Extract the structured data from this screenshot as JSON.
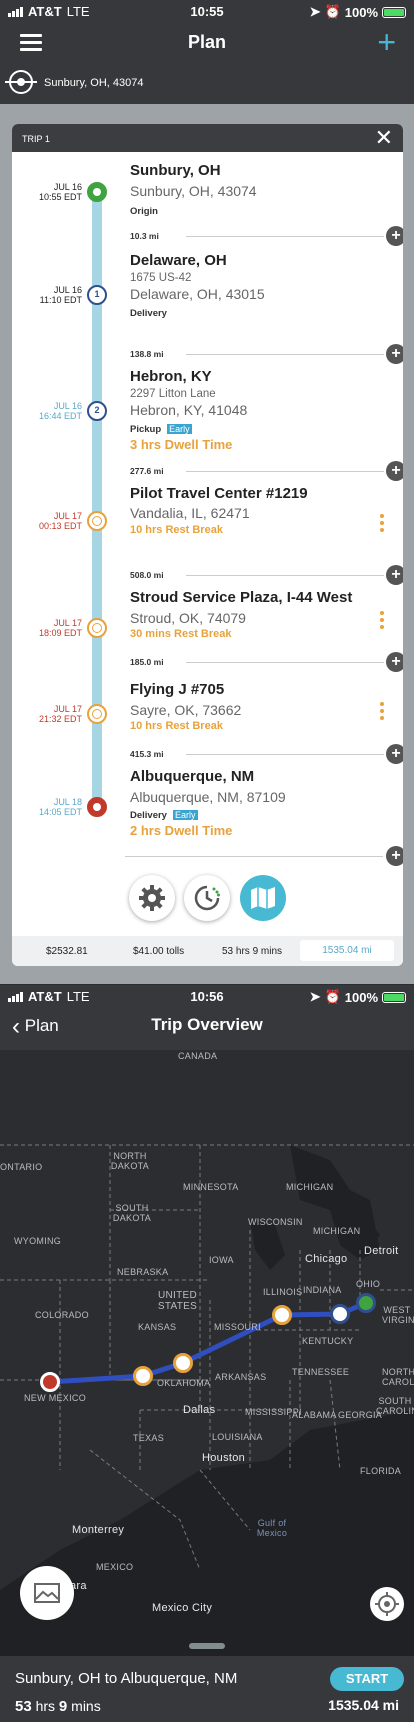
{
  "status1": {
    "carrier": "AT&T",
    "network": "LTE",
    "time": "10:55",
    "battery": "100%"
  },
  "plan": {
    "title": "Plan",
    "location": "Sunbury, OH, 43074",
    "trip_label": "TRIP 1",
    "stops": [
      {
        "date": "JUL 16",
        "time": "10:55 EDT",
        "name": "Sunbury, OH",
        "line1": "Sunbury, OH, 43074",
        "tag": "Origin"
      },
      {
        "date": "JUL 16",
        "time": "11:10 EDT",
        "name": "Delaware, OH",
        "line1": "1675 US-42",
        "line2": "Delaware, OH, 43015",
        "tag": "Delivery",
        "num": "1"
      },
      {
        "date": "JUL 16",
        "time": "16:44 EDT",
        "name": "Hebron, KY",
        "line1": "2297 Litton Lane",
        "line2": "Hebron, KY, 41048",
        "tag": "Pickup",
        "badge": "Early",
        "dwell": "3 hrs Dwell Time",
        "num": "2"
      },
      {
        "date": "JUL 17",
        "time": "00:13 EDT",
        "name": "Pilot Travel Center #1219",
        "line1": "Vandalia, IL, 62471",
        "rest": "10 hrs Rest Break"
      },
      {
        "date": "JUL 17",
        "time": "18:09 EDT",
        "name": "Stroud Service Plaza, I-44 West",
        "line1": "Stroud, OK, 74079",
        "rest": "30 mins Rest Break"
      },
      {
        "date": "JUL 17",
        "time": "21:32 EDT",
        "name": "Flying J #705",
        "line1": "Sayre, OK, 73662",
        "rest": "10 hrs Rest Break"
      },
      {
        "date": "JUL 18",
        "time": "14:05 EDT",
        "name": "Albuquerque, NM",
        "line1": "Albuquerque, NM, 87109",
        "tag": "Delivery",
        "badge": "Early",
        "dwell": "2 hrs Dwell Time"
      }
    ],
    "distances": [
      "10.3 mi",
      "138.8 mi",
      "277.6 mi",
      "508.0 mi",
      "185.0 mi",
      "415.3 mi"
    ],
    "summary": {
      "cost": "$2532.81",
      "tolls": "$41.00 tolls",
      "duration": "53 hrs 9 mins",
      "miles": "1535.04 mi"
    },
    "colors": {
      "accent": "#47b9d3",
      "orange": "#e8a23c",
      "red": "#c0392b",
      "green": "#3fa33f",
      "navy": "#2f4f8f"
    }
  },
  "status2": {
    "carrier": "AT&T",
    "network": "LTE",
    "time": "10:56",
    "battery": "100%"
  },
  "overview": {
    "back_label": "Plan",
    "title": "Trip Overview",
    "map_labels": {
      "canada": "CANADA",
      "ontario": "ONTARIO",
      "north_dakota": "NORTH DAKOTA",
      "minnesota": "MINNESOTA",
      "michigan": "MICHIGAN",
      "south_dakota": "SOUTH DAKOTA",
      "wisconsin": "WISCONSIN",
      "michigan2": "MICHIGAN",
      "wyoming": "WYOMING",
      "iowa": "IOWA",
      "nebraska": "NEBRASKA",
      "chicago": "Chicago",
      "detroit": "Detroit",
      "united_states": "UNITED STATES",
      "illinois": "ILLINOIS",
      "indiana": "INDIANA",
      "ohio": "OHIO",
      "colorado": "COLORADO",
      "kansas": "KANSAS",
      "missouri": "MISSOURI",
      "west_virginia": "WEST VIRGINIA",
      "kentucky": "KENTUCKY",
      "new_mexico": "NEW MEXICO",
      "oklahoma": "OKLAHOMA",
      "arkansas": "ARKANSAS",
      "tennessee": "TENNESSEE",
      "north_carolina": "NORTH CAROLINA",
      "south_carolina": "SOUTH CAROLINA",
      "dallas": "Dallas",
      "mississippi": "MISSISSIPPI",
      "alabama": "ALABAMA",
      "georgia": "GEORGIA",
      "texas": "TEXAS",
      "louisiana": "LOUISIANA",
      "houston": "Houston",
      "florida": "FLORIDA",
      "gulf": "Gulf of Mexico",
      "monterrey": "Monterrey",
      "mexico": "MEXICO",
      "ara": "ara",
      "mexico_city": "Mexico City"
    },
    "route": "Sunbury, OH to Albuquerque, NM",
    "duration_hrs": "53",
    "duration_hrs_unit": "hrs",
    "duration_mins": "9",
    "duration_mins_unit": "mins",
    "start_label": "START",
    "total_miles": "1535.04 mi"
  }
}
